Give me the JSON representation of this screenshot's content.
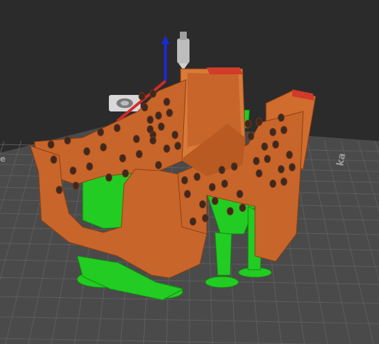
{
  "viewport": {
    "background": "#2b2b2b",
    "bed": {
      "color": "#4a4a4a",
      "grid_color": "#5a5a5a",
      "label_right": "ka",
      "label_left": "e"
    },
    "model": {
      "part_color": "#c8652a",
      "part_highlight": "#d97a38",
      "support_color": "#22cc22",
      "overhang_color": "#d23a2a"
    },
    "gizmo": {
      "z_axis_color": "#1a2ad8",
      "x_axis_color": "#d42a2a"
    },
    "icons": [
      "nozzle-icon",
      "printer-logo-icon"
    ]
  }
}
